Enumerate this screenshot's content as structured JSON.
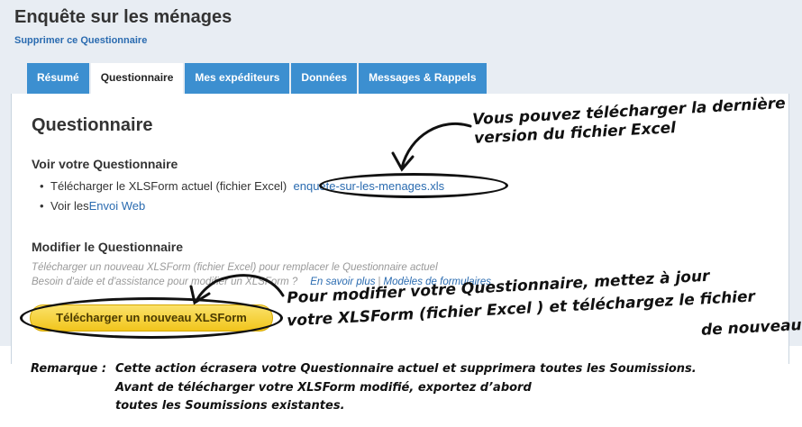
{
  "header": {
    "title": "Enquête sur les ménages",
    "delete_link": "Supprimer ce Questionnaire"
  },
  "tabs": [
    {
      "label": "Résumé",
      "active": false
    },
    {
      "label": "Questionnaire",
      "active": true
    },
    {
      "label": "Mes expéditeurs",
      "active": false
    },
    {
      "label": "Données",
      "active": false
    },
    {
      "label": "Messages & Rappels",
      "active": false
    }
  ],
  "main": {
    "heading": "Questionnaire",
    "view_section": {
      "heading": "Voir votre Questionnaire",
      "download_text": "Télécharger le XLSForm actuel (fichier Excel)",
      "file_link": "enquete-sur-les-menages.xls",
      "view_text": "Voir les",
      "web_link": "Envoi Web"
    },
    "modify_section": {
      "heading": "Modifier le Questionnaire",
      "help_line1": "Télécharger un nouveau XLSForm (fichier Excel) pour remplacer le Questionnaire actuel",
      "help_line2": "Besoin d'aide et d'assistance pour modifier un XLSForm ?",
      "learn_more_link": "En savoir plus",
      "separator": "|",
      "templates_link": "Modèles de formulaires",
      "upload_button": "Télécharger un nouveau XLSForm"
    }
  },
  "annotations": {
    "download_note_line1": "Vous pouvez télécharger la dernière",
    "download_note_line2": "version du fichier Excel",
    "upload_note_line1": "Pour modifier votre Questionnaire, mettez à jour",
    "upload_note_line2": "votre XLSForm (fichier Excel ) et téléchargez le fichier",
    "upload_note_line3": "de nouveau",
    "remark_label": "Remarque :",
    "remark_line1": "Cette action écrasera votre Questionnaire actuel et supprimera toutes les Soumissions.",
    "remark_line2": "Avant de télécharger votre XLSForm modifié, exportez d’abord",
    "remark_line3": "toutes les Soumissions existantes."
  },
  "colors": {
    "tab_blue": "#3c8fd0",
    "link_blue": "#2a6bb0",
    "button_yellow": "#f1c51c",
    "background": "#e8edf3"
  }
}
